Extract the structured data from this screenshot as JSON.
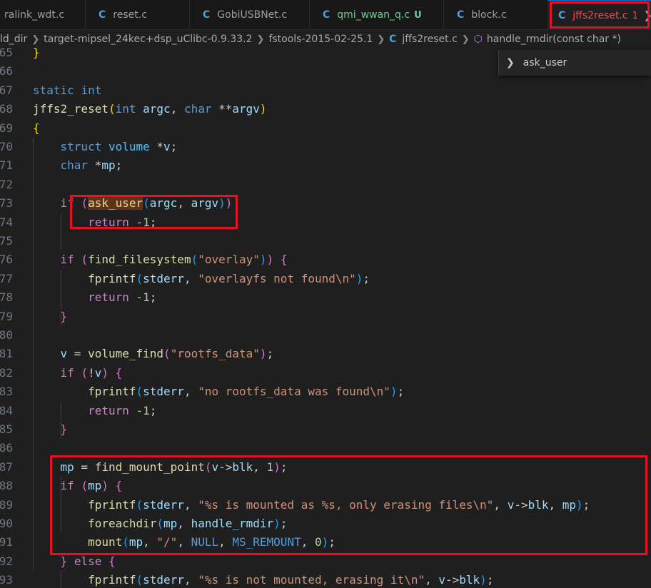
{
  "tabs": [
    {
      "title": "ralink_wdt.c",
      "status": "",
      "active": false,
      "icon": "c-file-icon"
    },
    {
      "title": "reset.c",
      "status": "",
      "active": false,
      "icon": "c-file-icon"
    },
    {
      "title": "GobiUSBNet.c",
      "status": "",
      "active": false,
      "icon": "c-file-icon"
    },
    {
      "title": "qmi_wwan_q.c",
      "status": "U",
      "active": false,
      "icon": "c-file-icon"
    },
    {
      "title": "block.c",
      "status": "",
      "active": false,
      "icon": "c-file-icon"
    },
    {
      "title": "jffs2reset.c",
      "status": "1",
      "active": true,
      "icon": "c-file-icon"
    }
  ],
  "breadcrumb": {
    "segments": [
      "ld_dir",
      "target-mipsel_24kec+dsp_uClibc-0.9.33.2",
      "fstools-2015-02-25.1",
      "jffs2reset.c",
      "handle_rmdir(const char *)"
    ],
    "file_icon": "C",
    "symbol_icon": "method-cube-icon"
  },
  "find_widget": {
    "value": "ask_user",
    "toggle_icon": "chevron-right-icon"
  },
  "code_lines": [
    {
      "num": "65",
      "tokens": [
        {
          "t": "}",
          "c": "brk1"
        }
      ]
    },
    {
      "num": "66",
      "tokens": []
    },
    {
      "num": "67",
      "tokens": [
        {
          "t": "static",
          "c": "kw"
        },
        {
          "t": " "
        },
        {
          "t": "int",
          "c": "kw"
        }
      ]
    },
    {
      "num": "68",
      "tokens": [
        {
          "t": "jffs2_reset",
          "c": "fn"
        },
        {
          "t": "(",
          "c": "brk1"
        },
        {
          "t": "int",
          "c": "kw"
        },
        {
          "t": " "
        },
        {
          "t": "argc",
          "c": "var"
        },
        {
          "t": ", "
        },
        {
          "t": "char",
          "c": "kw"
        },
        {
          "t": " **"
        },
        {
          "t": "argv",
          "c": "var"
        },
        {
          "t": ")",
          "c": "brk1"
        }
      ]
    },
    {
      "num": "69",
      "tokens": [
        {
          "t": "{",
          "c": "brk1"
        }
      ]
    },
    {
      "num": "70",
      "tokens": [
        {
          "t": "    "
        },
        {
          "t": "struct",
          "c": "kw"
        },
        {
          "t": " "
        },
        {
          "t": "volume",
          "c": "con"
        },
        {
          "t": " *"
        },
        {
          "t": "v",
          "c": "var"
        },
        {
          "t": ";"
        }
      ]
    },
    {
      "num": "71",
      "tokens": [
        {
          "t": "    "
        },
        {
          "t": "char",
          "c": "kw"
        },
        {
          "t": " *"
        },
        {
          "t": "mp",
          "c": "var"
        },
        {
          "t": ";"
        }
      ]
    },
    {
      "num": "72",
      "tokens": []
    },
    {
      "num": "73",
      "tokens": [
        {
          "t": "    "
        },
        {
          "t": "if",
          "c": "ctl"
        },
        {
          "t": " "
        },
        {
          "t": "(",
          "c": "brk2"
        },
        {
          "t": "ask_user",
          "c": "fn hl"
        },
        {
          "t": "(",
          "c": "brk3"
        },
        {
          "t": "argc",
          "c": "var"
        },
        {
          "t": ", "
        },
        {
          "t": "argv",
          "c": "var"
        },
        {
          "t": ")",
          "c": "brk3"
        },
        {
          "t": ")",
          "c": "brk2"
        }
      ]
    },
    {
      "num": "74",
      "tokens": [
        {
          "t": "        "
        },
        {
          "t": "return",
          "c": "ctl"
        },
        {
          "t": " -"
        },
        {
          "t": "1",
          "c": "num"
        },
        {
          "t": ";"
        }
      ]
    },
    {
      "num": "75",
      "tokens": []
    },
    {
      "num": "76",
      "tokens": [
        {
          "t": "    "
        },
        {
          "t": "if",
          "c": "ctl"
        },
        {
          "t": " "
        },
        {
          "t": "(",
          "c": "brk2"
        },
        {
          "t": "find_filesystem",
          "c": "fn"
        },
        {
          "t": "(",
          "c": "brk3"
        },
        {
          "t": "\"overlay\"",
          "c": "str"
        },
        {
          "t": ")",
          "c": "brk3"
        },
        {
          "t": ")",
          "c": "brk2"
        },
        {
          "t": " "
        },
        {
          "t": "{",
          "c": "brk2"
        }
      ]
    },
    {
      "num": "77",
      "tokens": [
        {
          "t": "        "
        },
        {
          "t": "fprintf",
          "c": "fn"
        },
        {
          "t": "(",
          "c": "brk3"
        },
        {
          "t": "stderr",
          "c": "var"
        },
        {
          "t": ", "
        },
        {
          "t": "\"overlayfs not found\\n\"",
          "c": "str"
        },
        {
          "t": ")",
          "c": "brk3"
        },
        {
          "t": ";"
        }
      ]
    },
    {
      "num": "78",
      "tokens": [
        {
          "t": "        "
        },
        {
          "t": "return",
          "c": "ctl"
        },
        {
          "t": " -"
        },
        {
          "t": "1",
          "c": "num"
        },
        {
          "t": ";"
        }
      ]
    },
    {
      "num": "79",
      "tokens": [
        {
          "t": "    "
        },
        {
          "t": "}",
          "c": "brk2"
        }
      ]
    },
    {
      "num": "80",
      "tokens": []
    },
    {
      "num": "81",
      "tokens": [
        {
          "t": "    "
        },
        {
          "t": "v",
          "c": "var"
        },
        {
          "t": " = "
        },
        {
          "t": "volume_find",
          "c": "fn"
        },
        {
          "t": "(",
          "c": "brk2"
        },
        {
          "t": "\"rootfs_data\"",
          "c": "str"
        },
        {
          "t": ")",
          "c": "brk2"
        },
        {
          "t": ";"
        }
      ]
    },
    {
      "num": "82",
      "tokens": [
        {
          "t": "    "
        },
        {
          "t": "if",
          "c": "ctl"
        },
        {
          "t": " "
        },
        {
          "t": "(",
          "c": "brk2"
        },
        {
          "t": "!"
        },
        {
          "t": "v",
          "c": "var"
        },
        {
          "t": ")",
          "c": "brk2"
        },
        {
          "t": " "
        },
        {
          "t": "{",
          "c": "brk2"
        }
      ]
    },
    {
      "num": "83",
      "tokens": [
        {
          "t": "        "
        },
        {
          "t": "fprintf",
          "c": "fn"
        },
        {
          "t": "(",
          "c": "brk3"
        },
        {
          "t": "stderr",
          "c": "var"
        },
        {
          "t": ", "
        },
        {
          "t": "\"no rootfs_data was found\\n\"",
          "c": "str"
        },
        {
          "t": ")",
          "c": "brk3"
        },
        {
          "t": ";"
        }
      ]
    },
    {
      "num": "84",
      "tokens": [
        {
          "t": "        "
        },
        {
          "t": "return",
          "c": "ctl"
        },
        {
          "t": " -"
        },
        {
          "t": "1",
          "c": "num"
        },
        {
          "t": ";"
        }
      ]
    },
    {
      "num": "85",
      "tokens": [
        {
          "t": "    "
        },
        {
          "t": "}",
          "c": "brk2"
        }
      ]
    },
    {
      "num": "86",
      "tokens": []
    },
    {
      "num": "87",
      "tokens": [
        {
          "t": "    "
        },
        {
          "t": "mp",
          "c": "var"
        },
        {
          "t": " = "
        },
        {
          "t": "find_mount_point",
          "c": "fn"
        },
        {
          "t": "(",
          "c": "brk2"
        },
        {
          "t": "v",
          "c": "var"
        },
        {
          "t": "->"
        },
        {
          "t": "blk",
          "c": "var"
        },
        {
          "t": ", "
        },
        {
          "t": "1",
          "c": "num"
        },
        {
          "t": ")",
          "c": "brk2"
        },
        {
          "t": ";"
        }
      ]
    },
    {
      "num": "88",
      "tokens": [
        {
          "t": "    "
        },
        {
          "t": "if",
          "c": "ctl"
        },
        {
          "t": " "
        },
        {
          "t": "(",
          "c": "brk2"
        },
        {
          "t": "mp",
          "c": "var"
        },
        {
          "t": ")",
          "c": "brk2"
        },
        {
          "t": " "
        },
        {
          "t": "{",
          "c": "brk2"
        }
      ]
    },
    {
      "num": "89",
      "tokens": [
        {
          "t": "        "
        },
        {
          "t": "fprintf",
          "c": "fn"
        },
        {
          "t": "(",
          "c": "brk3"
        },
        {
          "t": "stderr",
          "c": "var"
        },
        {
          "t": ", "
        },
        {
          "t": "\"%s is mounted as %s, only erasing files\\n\"",
          "c": "str"
        },
        {
          "t": ", "
        },
        {
          "t": "v",
          "c": "var"
        },
        {
          "t": "->"
        },
        {
          "t": "blk",
          "c": "var"
        },
        {
          "t": ", "
        },
        {
          "t": "mp",
          "c": "var"
        },
        {
          "t": ")",
          "c": "brk3"
        },
        {
          "t": ";"
        }
      ]
    },
    {
      "num": "90",
      "tokens": [
        {
          "t": "        "
        },
        {
          "t": "foreachdir",
          "c": "fn"
        },
        {
          "t": "(",
          "c": "brk3"
        },
        {
          "t": "mp",
          "c": "var"
        },
        {
          "t": ", "
        },
        {
          "t": "handle_rmdir",
          "c": "var"
        },
        {
          "t": ")",
          "c": "brk3"
        },
        {
          "t": ";"
        }
      ]
    },
    {
      "num": "91",
      "tokens": [
        {
          "t": "        "
        },
        {
          "t": "mount",
          "c": "fn"
        },
        {
          "t": "(",
          "c": "brk3"
        },
        {
          "t": "mp",
          "c": "var"
        },
        {
          "t": ", "
        },
        {
          "t": "\"/\"",
          "c": "str"
        },
        {
          "t": ", "
        },
        {
          "t": "NULL",
          "c": "kw"
        },
        {
          "t": ", "
        },
        {
          "t": "MS_REMOUNT",
          "c": "kw"
        },
        {
          "t": ", "
        },
        {
          "t": "0",
          "c": "num"
        },
        {
          "t": ")",
          "c": "brk3"
        },
        {
          "t": ";"
        }
      ]
    },
    {
      "num": "92",
      "tokens": [
        {
          "t": "    "
        },
        {
          "t": "}",
          "c": "brk2"
        },
        {
          "t": " "
        },
        {
          "t": "else",
          "c": "ctl"
        },
        {
          "t": " "
        },
        {
          "t": "{",
          "c": "brk2"
        }
      ]
    },
    {
      "num": "93",
      "tokens": [
        {
          "t": "        "
        },
        {
          "t": "fprintf",
          "c": "fn"
        },
        {
          "t": "(",
          "c": "brk3"
        },
        {
          "t": "stderr",
          "c": "var"
        },
        {
          "t": ", "
        },
        {
          "t": "\"%s is not mounted, erasing it\\n\"",
          "c": "str"
        },
        {
          "t": ", "
        },
        {
          "t": "v",
          "c": "var"
        },
        {
          "t": "->"
        },
        {
          "t": "blk",
          "c": "var"
        },
        {
          "t": ")",
          "c": "brk3"
        },
        {
          "t": ";"
        }
      ]
    }
  ],
  "colors": {
    "editor_bg": "#1f1f1f",
    "annotation_red": "#e81123",
    "keyword": "#569cd6",
    "control": "#c586c0",
    "function": "#dcdcaa",
    "string": "#ce9178",
    "number": "#b5cea8",
    "variable": "#9cdcfe",
    "match_highlight": "#613214"
  }
}
